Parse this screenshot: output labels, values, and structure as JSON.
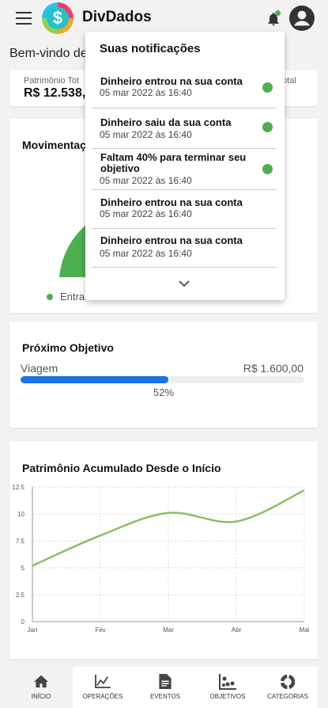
{
  "header": {
    "app_title": "DivDados",
    "logo_symbol": "$",
    "notification_dot_color": "#4caf50"
  },
  "welcome": {
    "text": "Bem-vindo de"
  },
  "summary": {
    "label_left": "Patrimônio Tot",
    "value_left": "R$ 12.538,",
    "label_right": "otal"
  },
  "movimentacao": {
    "title": "Movimentaçõ",
    "legend": "Entra",
    "color": "#4caf50"
  },
  "goal": {
    "title": "Próximo Objetivo",
    "name": "Viagem",
    "amount": "R$ 1.600,00",
    "progress": 0.52,
    "percent_label": "52%",
    "color": "#1a73e8"
  },
  "patrimonio": {
    "title": "Patrimônio Acumulado Desde o Início"
  },
  "chart_data": {
    "type": "line",
    "title": "Patrimônio Acumulado Desde o Início",
    "categories": [
      "Jan",
      "Fev",
      "Mar",
      "Abr",
      "Mai"
    ],
    "series": [
      {
        "values": [
          5.2,
          8.0,
          10.1,
          9.3,
          12.2
        ]
      }
    ],
    "yticks": [
      "12.5",
      "10",
      "7.5",
      "5",
      "2.5",
      "0"
    ],
    "ylim": [
      0,
      12.5
    ],
    "grid": true,
    "color": "#8bbf62"
  },
  "notifications": {
    "title": "Suas notificações",
    "items": [
      {
        "text": "Dinheiro entrou na sua conta",
        "date": "05 mar 2022 às 16:40",
        "unread": true
      },
      {
        "text": "Dinheiro saiu da sua conta",
        "date": "05 mar 2022 às 16:40",
        "unread": true
      },
      {
        "text": "Faltam 40% para terminar seu objetivo",
        "date": "05 mar 2022 às 16:40",
        "unread": true
      },
      {
        "text": "Dinheiro entrou na sua conta",
        "date": "05 mar 2022 às 16:40",
        "unread": false
      },
      {
        "text": "Dinheiro entrou na sua conta",
        "date": "05 mar 2022 às 16:40",
        "unread": false
      }
    ],
    "expand_icon": "chevron-down-icon"
  },
  "bottom_nav": [
    {
      "label": "INÍCIO",
      "icon": "home-icon",
      "active": true
    },
    {
      "label": "OPERAÇÕES",
      "icon": "trend-chart-icon",
      "active": false
    },
    {
      "label": "EVENTOS",
      "icon": "document-icon",
      "active": false
    },
    {
      "label": "OBJETIVOS",
      "icon": "scatter-icon",
      "active": false
    },
    {
      "label": "CATEGORIAS",
      "icon": "donut-icon",
      "active": false
    }
  ]
}
